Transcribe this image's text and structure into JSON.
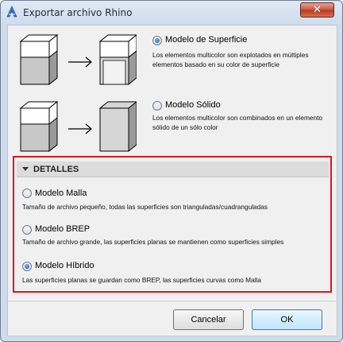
{
  "window": {
    "title": "Exportar archivo Rhino",
    "close_glyph": "✕",
    "app_icon": "archicad-icon"
  },
  "surface": {
    "label": "Modelo de Superficie",
    "checked": true,
    "description": "Los elementos multicolor son explotados en múltiples elementos basado en su color de superficie"
  },
  "solid": {
    "label": "Modelo Sólido",
    "checked": false,
    "description": "Los elementos multicolor son combinados en un elemento sólido de un sólo color"
  },
  "details": {
    "header": "DETALLES",
    "mesh": {
      "label": "Modelo Malla",
      "checked": false,
      "description": "Tamaño de archivo pequeño, todas las superficies son trianguladas/cuadranguladas"
    },
    "brep": {
      "label": "Modelo BREP",
      "checked": false,
      "description": "Tamaño de archivo grande, las superficies planas se mantienen como superficies simples"
    },
    "hybrid": {
      "label": "Modelo Híbrido",
      "checked": true,
      "description": "Las superficies planas se guardan como BREP, las superficies curvas como Malla"
    },
    "highlight_color": "#e0141b"
  },
  "buttons": {
    "cancel": "Cancelar",
    "ok": "OK"
  }
}
